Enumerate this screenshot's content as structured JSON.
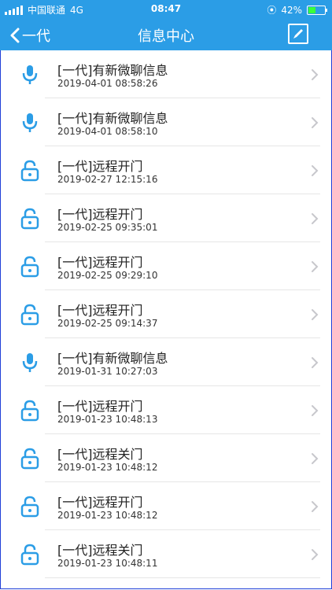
{
  "status_bar": {
    "carrier": "中国联通",
    "network": "4G",
    "time": "08:47",
    "battery": "42%",
    "battery_level": 0.42
  },
  "header": {
    "back_label": "一代",
    "title": "信息中心"
  },
  "colors": {
    "accent": "#2b9de6",
    "divider": "#e6e6e6",
    "text": "#222222"
  },
  "messages": [
    {
      "icon": "microphone-icon",
      "title": "[一代]有新微聊信息",
      "time": "2019-04-01 08:58:26"
    },
    {
      "icon": "microphone-icon",
      "title": "[一代]有新微聊信息",
      "time": "2019-04-01 08:58:10"
    },
    {
      "icon": "lock-icon",
      "title": "[一代]远程开门",
      "time": "2019-02-27 12:15:16"
    },
    {
      "icon": "lock-icon",
      "title": "[一代]远程开门",
      "time": "2019-02-25 09:35:01"
    },
    {
      "icon": "lock-icon",
      "title": "[一代]远程开门",
      "time": "2019-02-25 09:29:10"
    },
    {
      "icon": "lock-icon",
      "title": "[一代]远程开门",
      "time": "2019-02-25 09:14:37"
    },
    {
      "icon": "microphone-icon",
      "title": "[一代]有新微聊信息",
      "time": "2019-01-31 10:27:03"
    },
    {
      "icon": "lock-icon",
      "title": "[一代]远程开门",
      "time": "2019-01-23 10:48:13"
    },
    {
      "icon": "lock-icon",
      "title": "[一代]远程关门",
      "time": "2019-01-23 10:48:12"
    },
    {
      "icon": "lock-icon",
      "title": "[一代]远程开门",
      "time": "2019-01-23 10:48:12"
    },
    {
      "icon": "lock-icon",
      "title": "[一代]远程关门",
      "time": "2019-01-23 10:48:11"
    }
  ]
}
